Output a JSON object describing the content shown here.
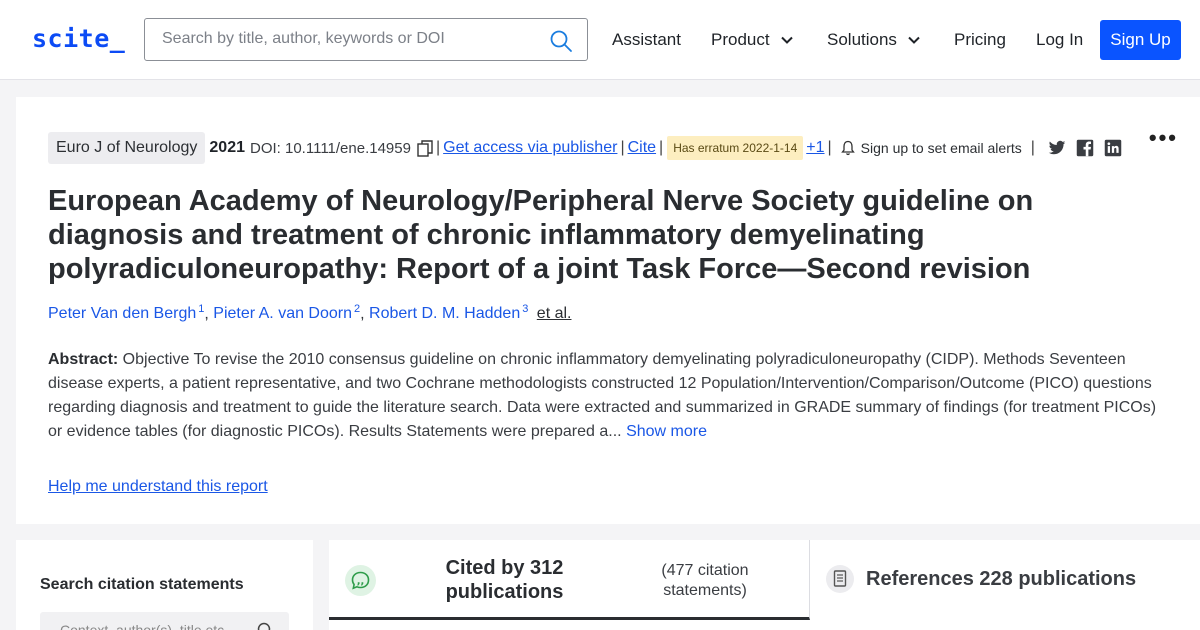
{
  "header": {
    "logo": "scite_",
    "search_placeholder": "Search by title, author, keywords or DOI",
    "nav": {
      "assistant": "Assistant",
      "product": "Product",
      "solutions": "Solutions",
      "pricing": "Pricing",
      "login": "Log In",
      "signup": "Sign Up"
    }
  },
  "paper": {
    "journal": "Euro J of Neurology",
    "year": "2021",
    "doi": "DOI: 10.1111/ene.14959",
    "access_link": "Get access via publisher",
    "cite_link": "Cite",
    "erratum_badge": "Has erratum 2022-1-14",
    "plus_count": "+1",
    "alerts_text": "Sign up to set email alerts",
    "title": "European Academy of Neurology/Peripheral Nerve Society guideline on diagnosis and treatment of chronic inflammatory demyelinating polyradiculoneuropathy: Report of a joint Task Force—Second revision",
    "authors": [
      {
        "name": "Peter Van den Bergh",
        "sup": "1"
      },
      {
        "name": "Pieter A. van Doorn",
        "sup": "2"
      },
      {
        "name": "Robert D. M. Hadden",
        "sup": "3"
      }
    ],
    "et_al": "et al.",
    "abstract_label": "Abstract:",
    "abstract_text": " Objective To revise the 2010 consensus guideline on chronic inflammatory demyelinating polyradiculoneuropathy (CIDP). Methods Seventeen disease experts, a patient representative, and two Cochrane methodologists constructed 12 Population/Intervention/Comparison/Outcome (PICO) questions regarding diagnosis and treatment to guide the literature search. Data were extracted and summarized in GRADE summary of findings (for treatment PICOs) or evidence tables (for diagnostic PICOs). Results Statements were prepared a...",
    "show_more": "Show more",
    "help_link": "Help me understand this report"
  },
  "citations": {
    "search_title": "Search citation statements",
    "search_placeholder": "Context, author(s), title etc",
    "cited_by": "Cited by 312 publications",
    "citation_statements": "(477 citation statements)",
    "references": "References 228 publications"
  },
  "icons": [
    "search-icon",
    "chevron-down-icon",
    "copy-icon",
    "bell-icon",
    "twitter-icon",
    "facebook-icon",
    "linkedin-icon",
    "more-options-icon",
    "quote-bubble-icon",
    "document-icon"
  ],
  "colors": {
    "brand": "#0c4bf5",
    "signup_bg": "#0a54ff",
    "link": "#1a57e6",
    "erratum_bg": "#fdeec0"
  }
}
